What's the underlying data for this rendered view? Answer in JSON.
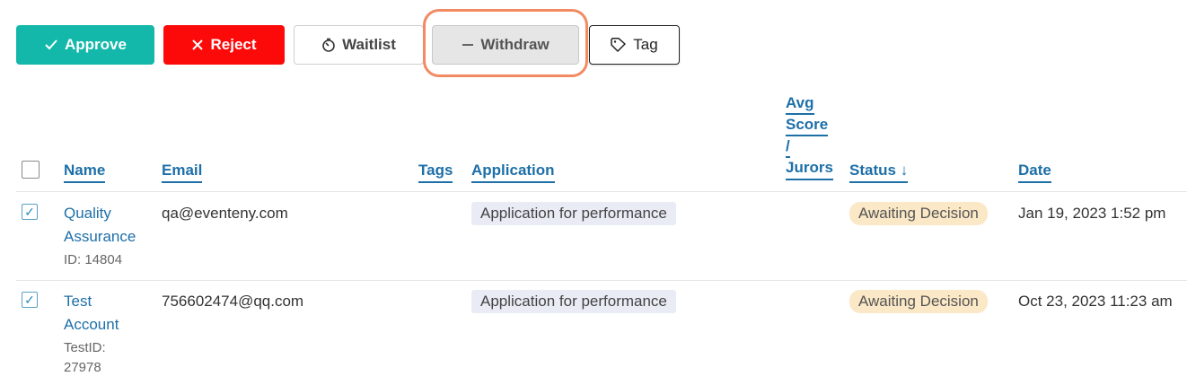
{
  "toolbar": {
    "approve_label": "Approve",
    "reject_label": "Reject",
    "waitlist_label": "Waitlist",
    "withdraw_label": "Withdraw",
    "tag_label": "Tag"
  },
  "colors": {
    "approve": "#13b8aa",
    "reject": "#fc0a0a",
    "link": "#1d6fa8",
    "highlight": "#f28a62",
    "status_pill": "#fbe8c6",
    "app_pill": "#e9ecf5"
  },
  "icons": {
    "approve": "check-icon",
    "reject": "x-icon",
    "waitlist": "timer-icon",
    "withdraw": "minus-icon",
    "tag": "tag-icon",
    "status_sort": "arrow-down-icon"
  },
  "table": {
    "headers": {
      "name": "Name",
      "email": "Email",
      "tags": "Tags",
      "application": "Application",
      "avg_score_line1": "Avg",
      "avg_score_line2": "Score",
      "avg_score_line3": "/",
      "avg_score_line4": "Jurors",
      "status": "Status",
      "status_sort_arrow": "↓",
      "date": "Date"
    },
    "rows": [
      {
        "checked": true,
        "name_line1": "Quality",
        "name_line2": "Assurance",
        "id_line1": "ID: 14804",
        "id_line2": "",
        "email": "qa@eventeny.com",
        "application": "Application for performance",
        "status": "Awaiting Decision",
        "date": "Jan 19, 2023 1:52 pm"
      },
      {
        "checked": true,
        "name_line1": "Test",
        "name_line2": "Account",
        "id_line1": "TestID:",
        "id_line2": "27978",
        "email": "756602474@qq.com",
        "application": "Application for performance",
        "status": "Awaiting Decision",
        "date": "Oct 23, 2023 11:23 am"
      }
    ]
  }
}
